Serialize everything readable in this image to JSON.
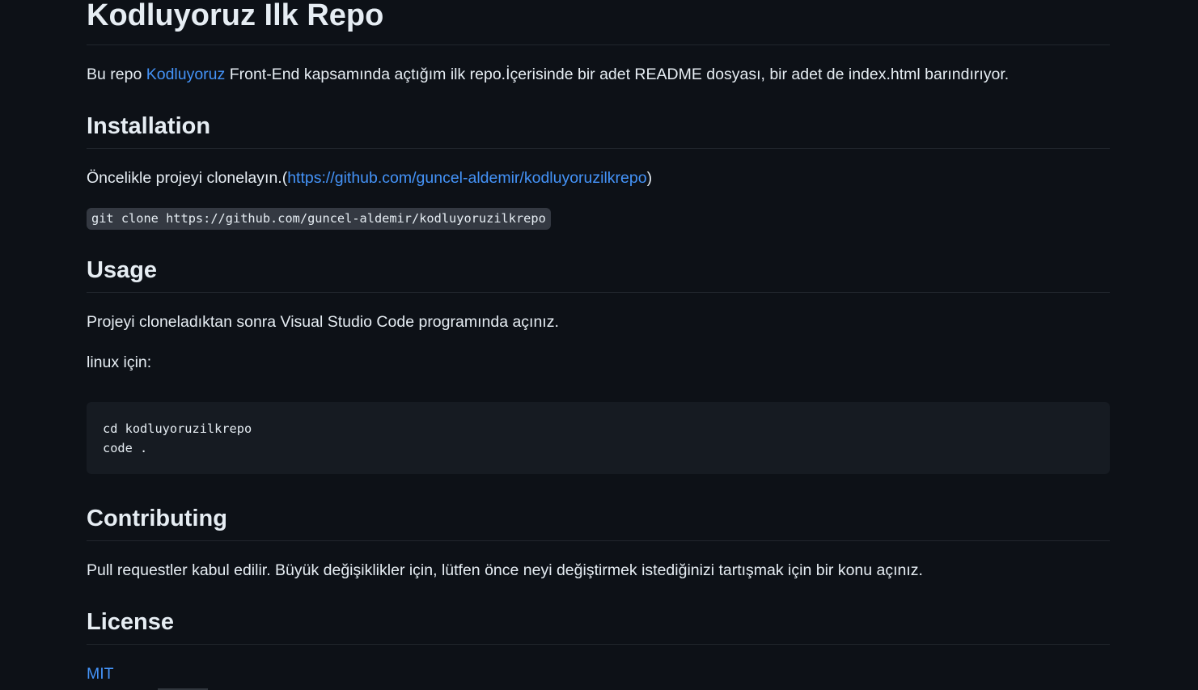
{
  "title": "Kodluyoruz Ilk Repo",
  "intro": {
    "prefix": "Bu repo ",
    "link_text": "Kodluyoruz",
    "suffix": " Front-End kapsamında açtığım ilk repo.İçerisinde bir adet README dosyası, bir adet de index.html barındırıyor."
  },
  "installation": {
    "heading": "Installation",
    "text_prefix": "Öncelikle projeyi clonelayın.(",
    "link_text": "https://github.com/guncel-aldemir/kodluyoruzilkrepo",
    "text_suffix": ")",
    "command": "git clone https://github.com/guncel-aldemir/kodluyoruzilkrepo"
  },
  "usage": {
    "heading": "Usage",
    "text": "Projeyi cloneladıktan sonra Visual Studio Code programında açınız.",
    "linux_label": "linux için:",
    "code_lines": [
      "cd kodluyoruzilkrepo",
      "code ."
    ]
  },
  "contributing": {
    "heading": "Contributing",
    "text": "Pull requestler kabul edilir. Büyük değişiklikler için, lütfen önce neyi değiştirmek istediğinizi tartışmak için bir konu açınız."
  },
  "license": {
    "heading": "License",
    "link_text": "MIT"
  },
  "colors": {
    "background": "#0d1117",
    "text": "#e6edf3",
    "link": "#4493f8",
    "code_block_bg": "#161b22",
    "inline_code_bg": "#343942",
    "divider": "#21262d"
  }
}
